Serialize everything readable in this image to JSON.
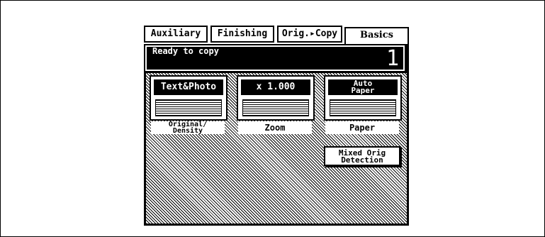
{
  "tabs": [
    {
      "label": "Auxiliary"
    },
    {
      "label": "Finishing"
    },
    {
      "label": "Orig.▸Copy"
    },
    {
      "label": "Basics"
    }
  ],
  "status": {
    "message": "Ready to copy",
    "copy_count": "1"
  },
  "functions": [
    {
      "value": "Text&Photo",
      "label_line1": "Original/",
      "label_line2": "Density"
    },
    {
      "value": "x 1.000",
      "label": "Zoom"
    },
    {
      "value_line1": "Auto",
      "value_line2": "Paper",
      "label": "Paper"
    }
  ],
  "mixed_button": {
    "line1": "Mixed Orig",
    "line2": "Detection"
  }
}
